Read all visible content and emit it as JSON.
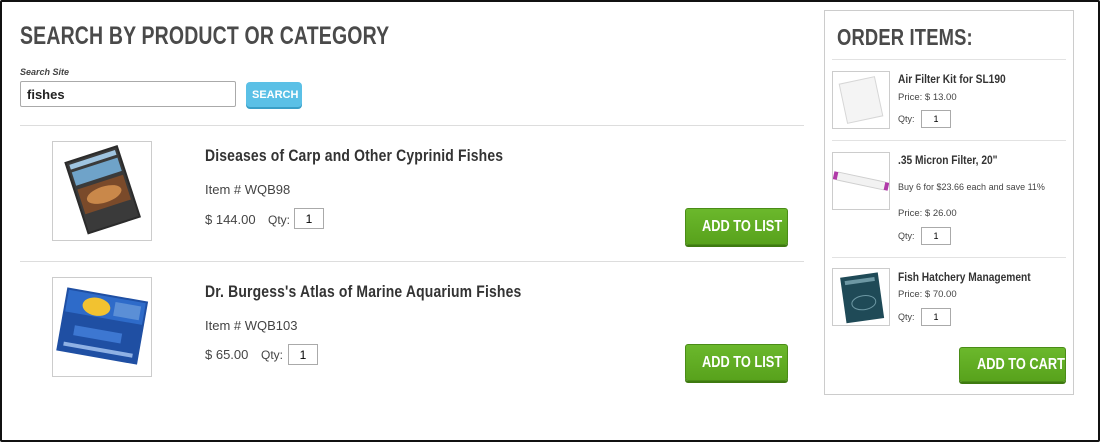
{
  "header": {
    "title": "SEARCH BY PRODUCT OR CATEGORY"
  },
  "search": {
    "label": "Search Site",
    "value": "fishes",
    "button_label": "SEARCH"
  },
  "results": [
    {
      "title": "Diseases of Carp and Other Cyprinid Fishes",
      "item": "Item # WQB98",
      "price": "$ 144.00",
      "qty_label": "Qty:",
      "qty": "1",
      "button_label": "ADD TO LIST"
    },
    {
      "title": "Dr. Burgess's Atlas of Marine Aquarium Fishes",
      "item": "Item # WQB103",
      "price": "$ 65.00",
      "qty_label": "Qty:",
      "qty": "1",
      "button_label": "ADD TO LIST"
    }
  ],
  "order": {
    "title": "ORDER ITEMS:",
    "items": [
      {
        "name": "Air Filter Kit for SL190",
        "price": "Price: $ 13.00",
        "qty_label": "Qty:",
        "qty": "1"
      },
      {
        "name": ".35 Micron Filter, 20\"",
        "promo": "Buy 6 for $23.66 each and save 11%",
        "price": "Price: $ 26.00",
        "qty_label": "Qty:",
        "qty": "1"
      },
      {
        "name": "Fish Hatchery Management",
        "price": "Price: $ 70.00",
        "qty_label": "Qty:",
        "qty": "1"
      }
    ],
    "cart_button_label": "ADD TO CART"
  },
  "colors": {
    "accent_green": "#5aa41d",
    "search_blue": "#5bc0e6"
  }
}
